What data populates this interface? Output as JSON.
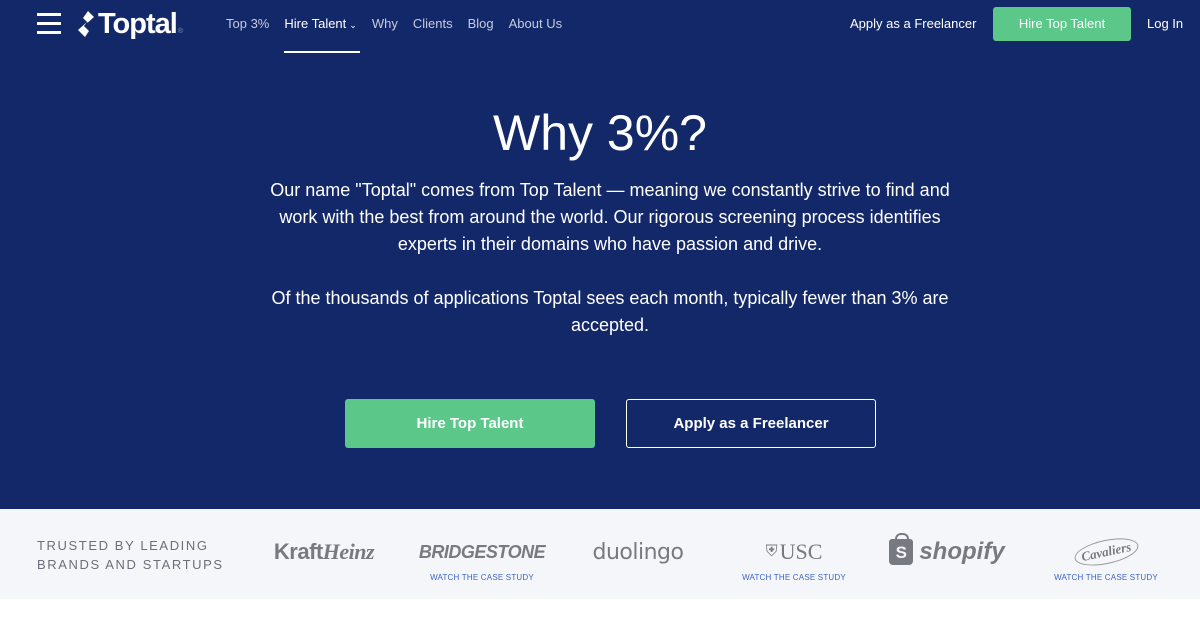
{
  "header": {
    "logo_text": "Toptal",
    "logo_reg": "®",
    "nav": [
      {
        "label": "Top 3%",
        "active": false
      },
      {
        "label": "Hire Talent",
        "active": true,
        "has_dropdown": true
      },
      {
        "label": "Why",
        "active": false
      },
      {
        "label": "Clients",
        "active": false
      },
      {
        "label": "Blog",
        "active": false
      },
      {
        "label": "About Us",
        "active": false
      }
    ],
    "dropdown_icon": "⌄",
    "apply_label": "Apply as a Freelancer",
    "hire_label": "Hire Top Talent",
    "login_label": "Log In"
  },
  "hero": {
    "title": "Why 3%?",
    "paragraph1": "Our name \"Toptal\" comes from Top Talent — meaning we constantly strive to find and work with the best from around the world. Our rigorous screening process identifies experts in their domains who have passion and drive.",
    "paragraph2": "Of the thousands of applications Toptal sees each month, typically fewer than 3% are accepted.",
    "hire_button": "Hire Top Talent",
    "apply_button": "Apply as a Freelancer"
  },
  "trusted": {
    "label_line1": "TRUSTED BY LEADING",
    "label_line2": "BRANDS AND STARTUPS",
    "brands": [
      {
        "name": "KraftHeinz",
        "part1": "Kraft",
        "part2": "Heinz",
        "case_study": null
      },
      {
        "name": "BRIDGESTONE",
        "case_study": "WATCH THE CASE STUDY"
      },
      {
        "name": "duolingo",
        "case_study": null
      },
      {
        "name": "USC",
        "crest": "⛨",
        "case_study": "WATCH THE CASE STUDY"
      },
      {
        "name": "shopify",
        "bag_letter": "S",
        "case_study": null
      },
      {
        "name": "Cavaliers",
        "case_study": "WATCH THE CASE STUDY"
      }
    ]
  },
  "colors": {
    "hero_bg": "#132869",
    "accent_green": "#5bc88a",
    "link_blue": "#3b63c7",
    "trusted_bg": "#f5f6fa"
  }
}
